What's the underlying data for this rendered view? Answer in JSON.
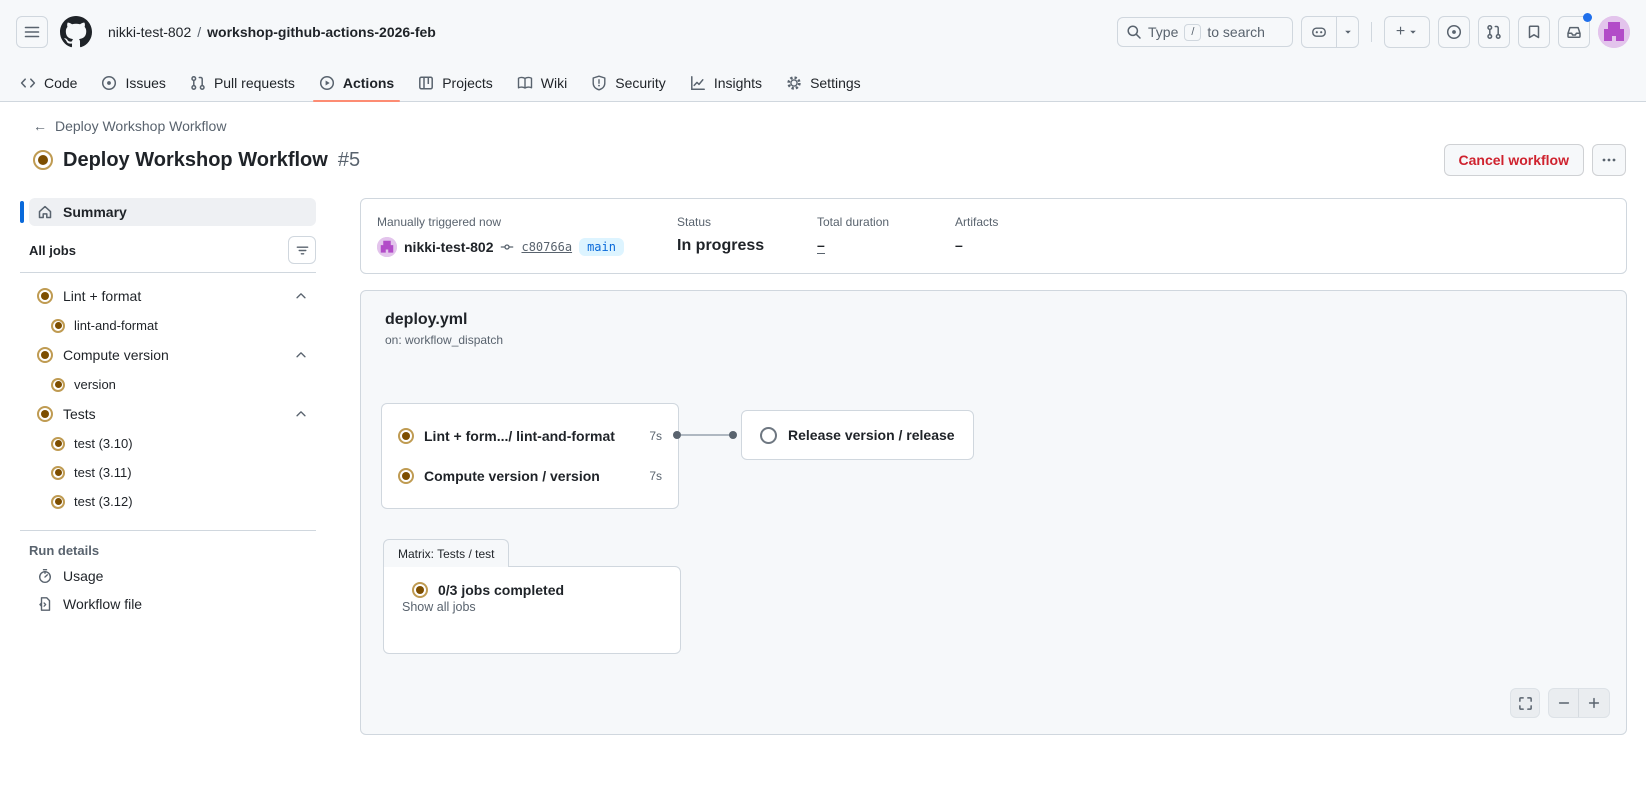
{
  "header": {
    "owner": "nikki-test-802",
    "separator": "/",
    "repo": "workshop-github-actions-2026-feb",
    "search": {
      "pre": "Type",
      "key": "/",
      "post": "to search"
    }
  },
  "nav": {
    "tabs": [
      {
        "label": "Code",
        "selected": false
      },
      {
        "label": "Issues",
        "selected": false
      },
      {
        "label": "Pull requests",
        "selected": false
      },
      {
        "label": "Actions",
        "selected": true
      },
      {
        "label": "Projects",
        "selected": false
      },
      {
        "label": "Wiki",
        "selected": false
      },
      {
        "label": "Security",
        "selected": false
      },
      {
        "label": "Insights",
        "selected": false
      },
      {
        "label": "Settings",
        "selected": false
      }
    ]
  },
  "page": {
    "back_label": "Deploy Workshop Workflow",
    "title": "Deploy Workshop Workflow",
    "run_number": "#5",
    "cancel_button": "Cancel workflow"
  },
  "sidebar": {
    "summary": "Summary",
    "all_jobs": "All jobs",
    "groups": [
      {
        "label": "Lint + format",
        "jobs": [
          "lint-and-format"
        ]
      },
      {
        "label": "Compute version",
        "jobs": [
          "version"
        ]
      },
      {
        "label": "Tests",
        "jobs": [
          "test (3.10)",
          "test (3.11)",
          "test (3.12)"
        ]
      }
    ],
    "run_details": "Run details",
    "usage": "Usage",
    "workflow_file": "Workflow file"
  },
  "summary_card": {
    "trigger_label": "Manually triggered now",
    "actor": "nikki-test-802",
    "commit": "c80766a",
    "branch": "main",
    "status_label": "Status",
    "status_value": "In progress",
    "duration_label": "Total duration",
    "duration_value": "–",
    "artifacts_label": "Artifacts",
    "artifacts_value": "–"
  },
  "graph": {
    "file": "deploy.yml",
    "trigger": "on: workflow_dispatch",
    "node1": {
      "row1_label": "Lint + form.../ lint-and-format",
      "row1_duration": "7s",
      "row2_label": "Compute version / version",
      "row2_duration": "7s"
    },
    "release_label": "Release version / release",
    "matrix_tab": "Matrix: Tests / test",
    "matrix_status": "0/3 jobs completed",
    "show_all_jobs": "Show all jobs"
  },
  "icons": {
    "back_arrow": "←",
    "plus": "+"
  },
  "colors": {
    "accent_blue": "#0969da",
    "tab_underline": "#fd8c73",
    "danger_red": "#cf222e",
    "in_progress_ring": "#bf9b52",
    "in_progress_dot": "#7d4e00",
    "branch_badge_bg": "#ddf4ff",
    "border": "#d0d7de",
    "muted_text": "#59636e",
    "header_bg": "#f6f8fa",
    "notification_dot": "#1f6feb"
  }
}
